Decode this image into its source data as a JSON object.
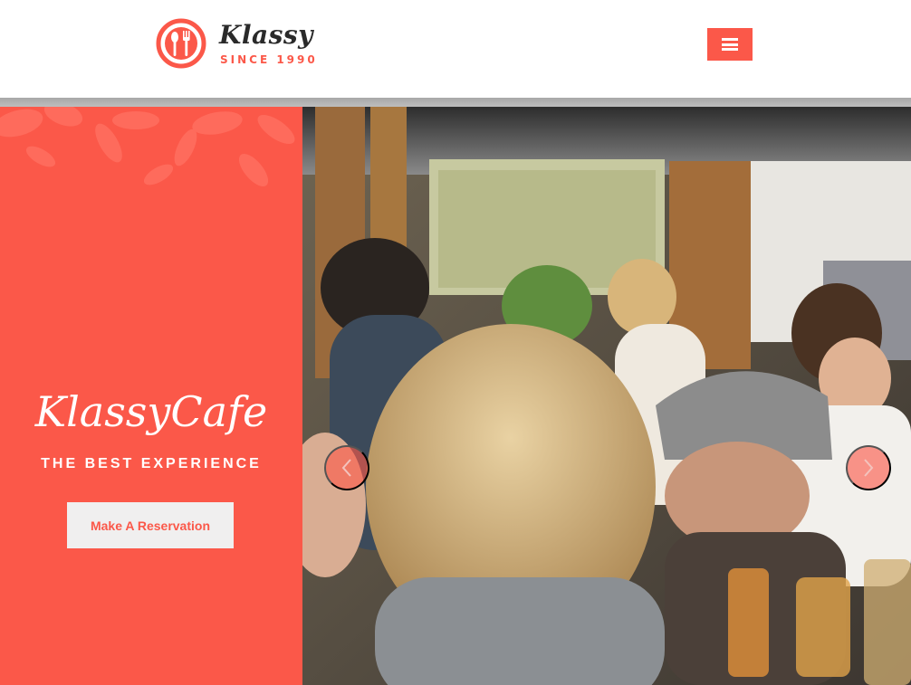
{
  "header": {
    "logo": {
      "name": "Klassy",
      "tagline": "SINCE 1990"
    },
    "menu_icon": "hamburger-menu-icon"
  },
  "hero": {
    "title": "KlassyCafe",
    "subtitle": "THE BEST EXPERIENCE",
    "cta_label": "Make A Reservation",
    "prev_icon": "chevron-left-icon",
    "next_icon": "chevron-right-icon"
  },
  "colors": {
    "accent": "#fb5849",
    "button_bg": "#f0efef",
    "text_dark": "#2a2a2a"
  }
}
